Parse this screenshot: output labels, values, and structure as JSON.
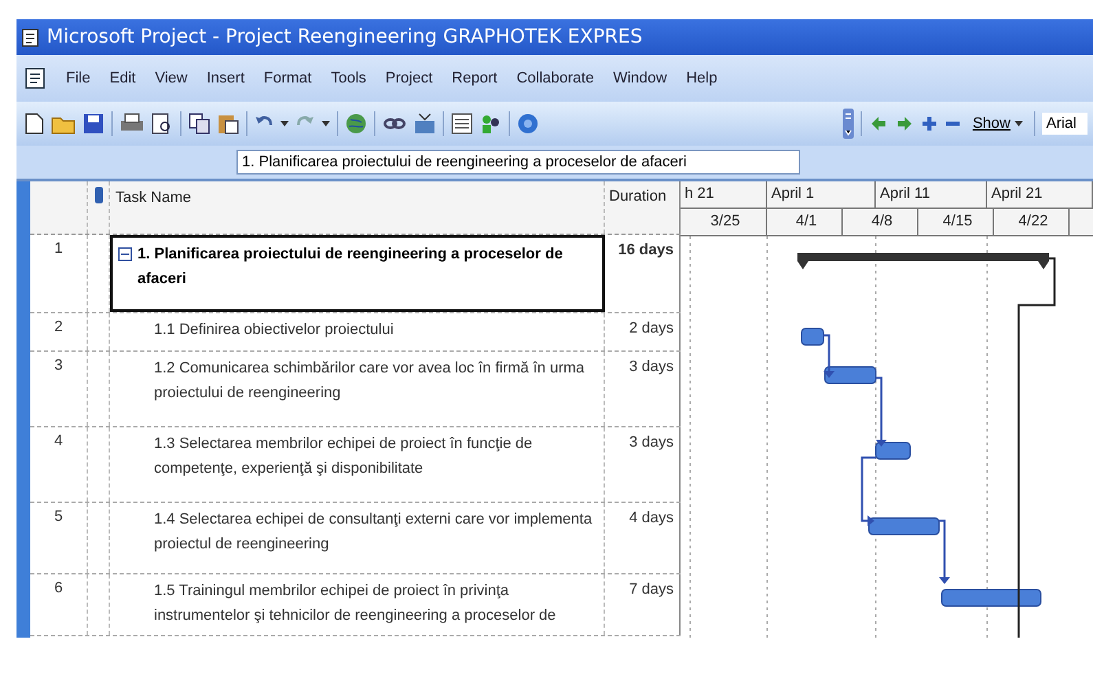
{
  "window": {
    "title": "Microsoft Project - Project Reengineering GRAPHOTEK EXPRES"
  },
  "menu": [
    "File",
    "Edit",
    "View",
    "Insert",
    "Format",
    "Tools",
    "Project",
    "Report",
    "Collaborate",
    "Window",
    "Help"
  ],
  "toolbar": {
    "show_button": "Show",
    "font_field": "Arial"
  },
  "entry_bar": {
    "value": "1. Planificarea proiectului de reengineering a proceselor de afaceri"
  },
  "table": {
    "columns": [
      "Task Name",
      "Duration"
    ],
    "rows": [
      {
        "id": "1",
        "name": "1. Planificarea proiectului de reengineering a proceselor de afaceri",
        "duration": "16 days",
        "kind": "summary",
        "expanded": true,
        "selected": true
      },
      {
        "id": "2",
        "name": "1.1 Definirea obiectivelor proiectului",
        "duration": "2 days",
        "kind": "task",
        "selected": false
      },
      {
        "id": "3",
        "name": "1.2 Comunicarea schimbărilor care vor avea loc în firmă în urma proiectului de reengineering",
        "duration": "3 days",
        "kind": "task",
        "selected": false
      },
      {
        "id": "4",
        "name": "1.3 Selectarea membrilor echipei de proiect în funcţie de competenţe, experienţă şi disponibilitate",
        "duration": "3 days",
        "kind": "task",
        "selected": false
      },
      {
        "id": "5",
        "name": "1.4 Selectarea echipei de consultanţi externi care vor implementa proiectul de reengineering",
        "duration": "4 days",
        "kind": "task",
        "selected": false
      },
      {
        "id": "6",
        "name": "1.5 Trainingul membrilor echipei de proiect în privinţa instrumentelor şi tehnicilor de reengineering a proceselor de",
        "duration": "7 days",
        "kind": "task",
        "selected": false
      }
    ]
  },
  "gantt": {
    "timescale_top": [
      "h 21",
      "April 1",
      "April 11",
      "April 21"
    ],
    "timescale_bottom": [
      "3/25",
      "4/1",
      "4/8",
      "4/15",
      "4/22"
    ]
  }
}
